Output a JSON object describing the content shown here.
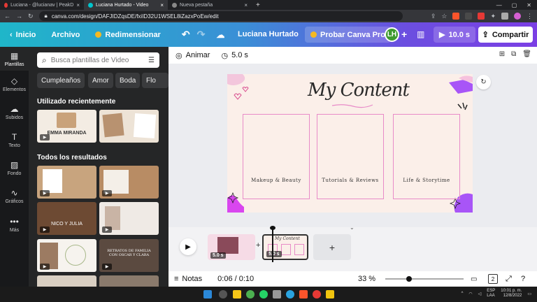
{
  "browser": {
    "tabs": [
      {
        "label": "Luciana - @lucianav | PeakD",
        "active": false
      },
      {
        "label": "Luciana Hurtado - Video",
        "active": true
      },
      {
        "label": "Nueva pestaña",
        "active": false
      }
    ],
    "url": "canva.com/design/DAFJIDZqsDE/fxiID32U1WSEL8iZazxPoEw/edit"
  },
  "header": {
    "home_label": "Inicio",
    "file_label": "Archivo",
    "resize_label": "Redimensionar",
    "design_title": "Luciana Hurtado",
    "pro_label": "Probar Canva Pro",
    "avatar_initials": "LH",
    "duration_label": "10.0 s",
    "share_label": "Compartir"
  },
  "rail": {
    "items": [
      {
        "label": "Plantillas",
        "icon": "templates-icon"
      },
      {
        "label": "Elementos",
        "icon": "elements-icon"
      },
      {
        "label": "Subidos",
        "icon": "upload-icon"
      },
      {
        "label": "Texto",
        "icon": "text-icon"
      },
      {
        "label": "Fondo",
        "icon": "background-icon"
      },
      {
        "label": "Gráficos",
        "icon": "charts-icon"
      },
      {
        "label": "Más",
        "icon": "more-icon"
      }
    ]
  },
  "panel": {
    "search_placeholder": "Busca plantillas de Video",
    "chips": [
      "Cumpleaños",
      "Amor",
      "Boda",
      "Flo"
    ],
    "recent_title": "Utilizado recientemente",
    "recent_thumb_1_text": "EMMA MIRANDA",
    "all_title": "Todos los resultados",
    "thumb_nico_text": "NICO Y JULIA",
    "thumb_retratos_text": "RETRATOS DE FAMILIA CON OSCAR Y CLARA"
  },
  "toolbar": {
    "animate_label": "Animar",
    "time_label": "5.0 s"
  },
  "canvas": {
    "title": "My Content",
    "frames": [
      "Makeup & Beauty",
      "Tutorials & Reviews",
      "Life & Storytime"
    ]
  },
  "timeline": {
    "clip1_time": "5.0 s",
    "clip2_time": "5.0 s",
    "clip2_title": "My Content"
  },
  "bottombar": {
    "notes_label": "Notas",
    "time_display": "0:06 / 0:10",
    "zoom": "33 %",
    "page_count": "2"
  },
  "taskbar": {
    "lang_1": "ESP",
    "lang_2": "LAA",
    "clock_time": "10:01 p. m.",
    "clock_date": "12/8/2022"
  },
  "colors": {
    "canva_gradient_start": "#1fb6c9",
    "canva_gradient_end": "#7b3fe4",
    "panel_bg": "#252627",
    "frame_pink": "#e88bc8",
    "canvas_bg": "#fbefe9"
  }
}
